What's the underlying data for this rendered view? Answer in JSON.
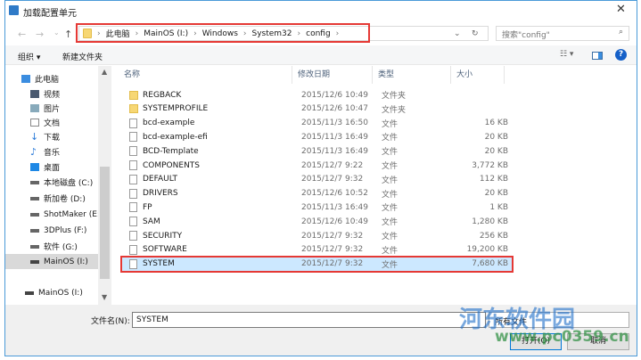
{
  "window": {
    "title": "加载配置单元",
    "close": "✕"
  },
  "address": {
    "crumbs": [
      "此电脑",
      "MainOS (I:)",
      "Windows",
      "System32",
      "config"
    ],
    "search_placeholder": "搜索\"config\""
  },
  "toolbar": {
    "organize": "组织 ▾",
    "new_folder": "新建文件夹",
    "help": "?"
  },
  "nav": {
    "items": [
      "此电脑",
      "视频",
      "图片",
      "文档",
      "下载",
      "音乐",
      "桌面",
      "本地磁盘 (C:)",
      "新加卷 (D:)",
      "ShotMaker (E:)",
      "3DPlus (F:)",
      "软件 (G:)",
      "MainOS (I:)",
      "MainOS (I:)"
    ]
  },
  "columns": {
    "name": "名称",
    "date": "修改日期",
    "type": "类型",
    "size": "大小"
  },
  "files": [
    {
      "name": "REGBACK",
      "date": "2015/12/6 10:49",
      "type": "文件夹",
      "size": "",
      "folder": true
    },
    {
      "name": "SYSTEMPROFILE",
      "date": "2015/12/6 10:47",
      "type": "文件夹",
      "size": "",
      "folder": true
    },
    {
      "name": "bcd-example",
      "date": "2015/11/3 16:50",
      "type": "文件",
      "size": "16 KB"
    },
    {
      "name": "bcd-example-efi",
      "date": "2015/11/3 16:49",
      "type": "文件",
      "size": "20 KB"
    },
    {
      "name": "BCD-Template",
      "date": "2015/11/3 16:49",
      "type": "文件",
      "size": "20 KB"
    },
    {
      "name": "COMPONENTS",
      "date": "2015/12/7 9:22",
      "type": "文件",
      "size": "3,772 KB"
    },
    {
      "name": "DEFAULT",
      "date": "2015/12/7 9:32",
      "type": "文件",
      "size": "112 KB"
    },
    {
      "name": "DRIVERS",
      "date": "2015/12/6 10:52",
      "type": "文件",
      "size": "20 KB"
    },
    {
      "name": "FP",
      "date": "2015/11/3 16:49",
      "type": "文件",
      "size": "1 KB"
    },
    {
      "name": "SAM",
      "date": "2015/12/6 10:49",
      "type": "文件",
      "size": "1,280 KB"
    },
    {
      "name": "SECURITY",
      "date": "2015/12/7 9:32",
      "type": "文件",
      "size": "256 KB"
    },
    {
      "name": "SOFTWARE",
      "date": "2015/12/7 9:32",
      "type": "文件",
      "size": "19,200 KB"
    },
    {
      "name": "SYSTEM",
      "date": "2015/12/7 9:32",
      "type": "文件",
      "size": "7,680 KB"
    }
  ],
  "footer": {
    "filename_label": "文件名(N):",
    "filename_value": "SYSTEM",
    "filter": "所有文件",
    "open": "打开(O)",
    "cancel": "取消"
  },
  "watermark": {
    "text": "河东软件园",
    "url": "www.pc0359.cn"
  }
}
